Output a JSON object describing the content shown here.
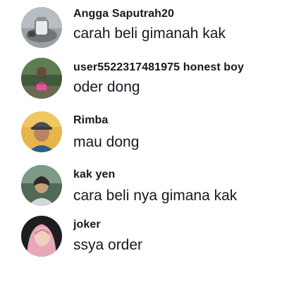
{
  "comments": [
    {
      "username": "Angga Saputrah20",
      "text": "carah beli gimanah kak",
      "avatar": "avatar-glass-jar-photo"
    },
    {
      "username": "user5522317481975 honest boy",
      "text": "oder dong",
      "avatar": "avatar-person-outdoor-photo"
    },
    {
      "username": "Rimba",
      "text": "mau dong",
      "avatar": "avatar-man-cap-photo"
    },
    {
      "username": "kak yen",
      "text": "cara beli nya gimana kak",
      "avatar": "avatar-woman-photo"
    },
    {
      "username": "joker",
      "text": "ssya order",
      "avatar": "avatar-hijab-woman-photo"
    }
  ]
}
